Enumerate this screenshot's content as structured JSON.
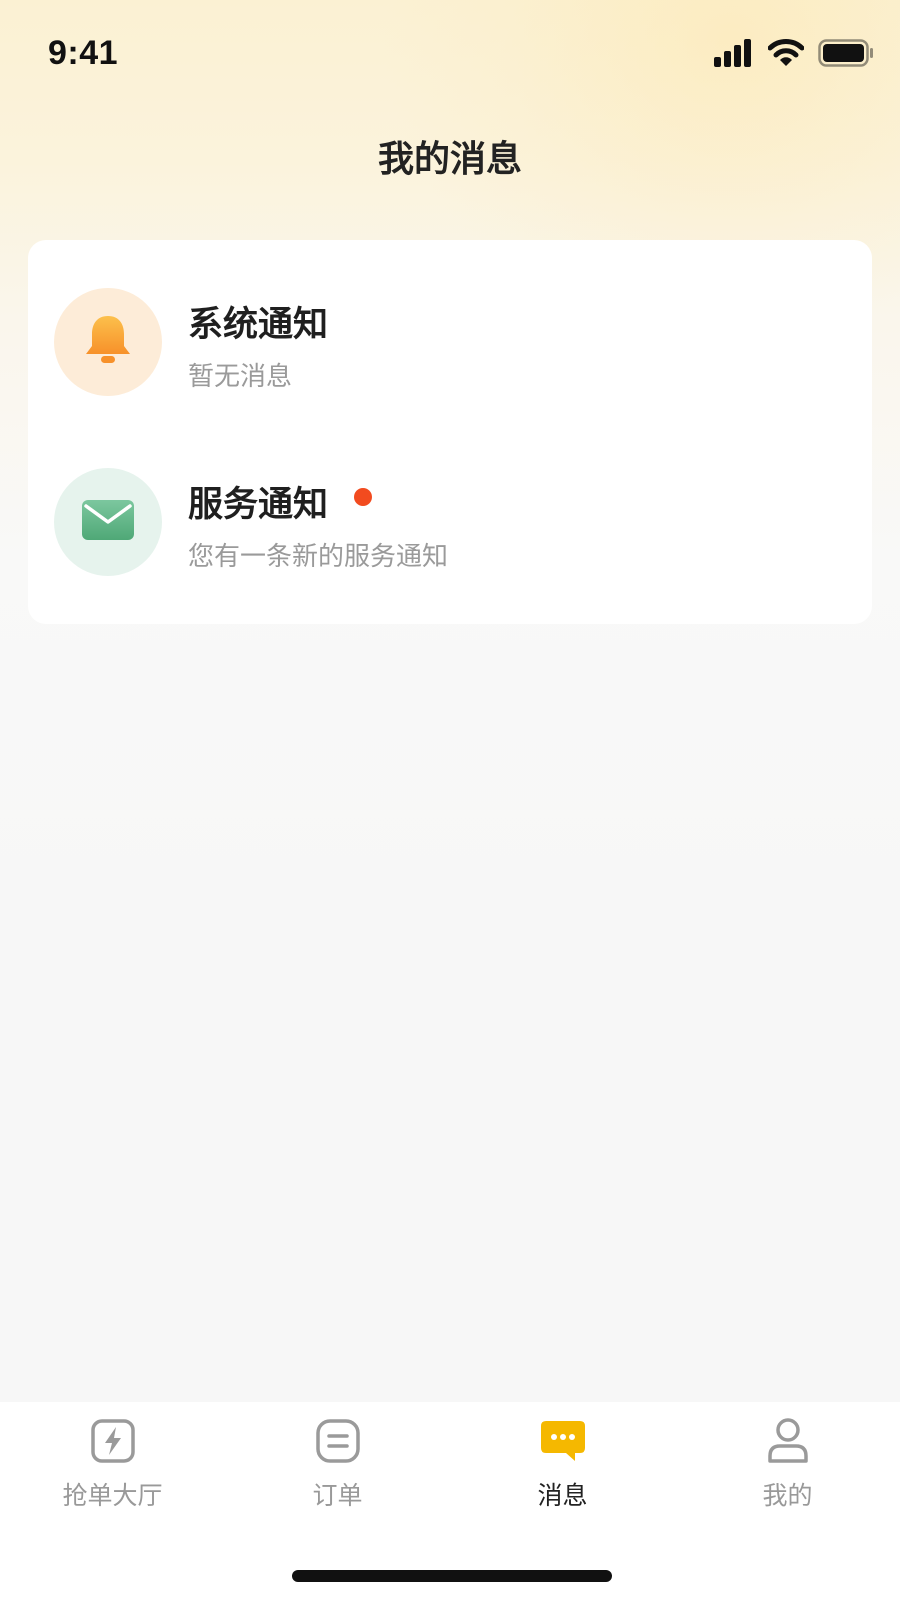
{
  "status_bar": {
    "time": "9:41",
    "icons": [
      "cellular-signal-icon",
      "wifi-icon",
      "battery-icon"
    ]
  },
  "header": {
    "title": "我的消息"
  },
  "messages": [
    {
      "title": "系统通知",
      "subtitle": "暂无消息",
      "icon": "bell-icon",
      "unread": false
    },
    {
      "title": "服务通知",
      "subtitle": "您有一条新的服务通知",
      "icon": "mail-icon",
      "unread": true
    }
  ],
  "tab_bar": {
    "tabs": [
      {
        "label": "抢单大厅",
        "icon": "lightning-icon",
        "active": false
      },
      {
        "label": "订单",
        "icon": "order-list-icon",
        "active": false
      },
      {
        "label": "消息",
        "icon": "chat-bubble-icon",
        "active": true
      },
      {
        "label": "我的",
        "icon": "user-icon",
        "active": false
      }
    ]
  },
  "colors": {
    "accent": "#f5b800",
    "unread_dot": "#f24b1f",
    "bell_orange": "#f9a53a",
    "mail_green": "#5db486",
    "inactive_text": "#999999"
  }
}
